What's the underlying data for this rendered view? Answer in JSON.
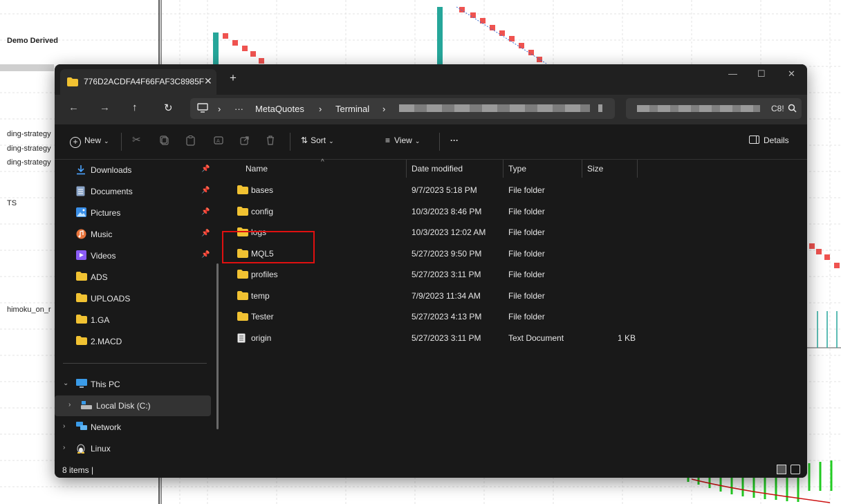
{
  "background": {
    "labels": [
      "Demo Derived",
      "ding-strategy",
      "ding-strategy",
      "ding-strategy",
      "TS",
      "himoku_on_r"
    ]
  },
  "window": {
    "tab_title": "776D2ACDFA4F66FAF3C8985F",
    "tab_close": "✕",
    "new_tab": "+",
    "controls": {
      "minimize": "—",
      "maximize": "☐",
      "close": "✕"
    }
  },
  "nav": {
    "back": "←",
    "forward": "→",
    "up": "↑",
    "refresh": "↻",
    "breadcrumbs": [
      "MetaQuotes",
      "Terminal"
    ],
    "overflow": "···",
    "separator": "›",
    "search_suffix": "C8!"
  },
  "toolbar": {
    "new_label": "New",
    "sort_label": "Sort",
    "view_label": "View",
    "more_label": "···",
    "details_label": "Details"
  },
  "sidebar": {
    "quick_access": [
      {
        "label": "Downloads",
        "icon": "download-icon",
        "pinned": true
      },
      {
        "label": "Documents",
        "icon": "documents-icon",
        "pinned": true
      },
      {
        "label": "Pictures",
        "icon": "pictures-icon",
        "pinned": true
      },
      {
        "label": "Music",
        "icon": "music-icon",
        "pinned": true
      },
      {
        "label": "Videos",
        "icon": "videos-icon",
        "pinned": true
      },
      {
        "label": "ADS",
        "icon": "folder-icon",
        "pinned": false
      },
      {
        "label": "UPLOADS",
        "icon": "folder-icon",
        "pinned": false
      },
      {
        "label": "1.GA",
        "icon": "folder-icon",
        "pinned": false
      },
      {
        "label": "2.MACD",
        "icon": "folder-icon",
        "pinned": false
      }
    ],
    "this_pc": "This PC",
    "local_disk": "Local Disk (C:)",
    "network": "Network",
    "linux": "Linux"
  },
  "files": {
    "columns": {
      "name": "Name",
      "date": "Date modified",
      "type": "Type",
      "size": "Size"
    },
    "rows": [
      {
        "name": "bases",
        "date": "9/7/2023 5:18 PM",
        "type": "File folder",
        "size": "",
        "icon": "folder-icon"
      },
      {
        "name": "config",
        "date": "10/3/2023 8:46 PM",
        "type": "File folder",
        "size": "",
        "icon": "folder-icon"
      },
      {
        "name": "logs",
        "date": "10/3/2023 12:02 AM",
        "type": "File folder",
        "size": "",
        "icon": "folder-icon"
      },
      {
        "name": "MQL5",
        "date": "5/27/2023 9:50 PM",
        "type": "File folder",
        "size": "",
        "icon": "folder-icon"
      },
      {
        "name": "profiles",
        "date": "5/27/2023 3:11 PM",
        "type": "File folder",
        "size": "",
        "icon": "folder-icon"
      },
      {
        "name": "temp",
        "date": "7/9/2023 11:34 AM",
        "type": "File folder",
        "size": "",
        "icon": "folder-icon"
      },
      {
        "name": "Tester",
        "date": "5/27/2023 4:13 PM",
        "type": "File folder",
        "size": "",
        "icon": "folder-icon"
      },
      {
        "name": "origin",
        "date": "5/27/2023 3:11 PM",
        "type": "Text Document",
        "size": "1 KB",
        "icon": "text-file-icon"
      }
    ]
  },
  "status": {
    "items": "8 items  |"
  },
  "colors": {
    "folder": "#f1c232",
    "highlight": "#e01010",
    "candle_up": "#26a69a",
    "candle_down": "#ef5350"
  }
}
